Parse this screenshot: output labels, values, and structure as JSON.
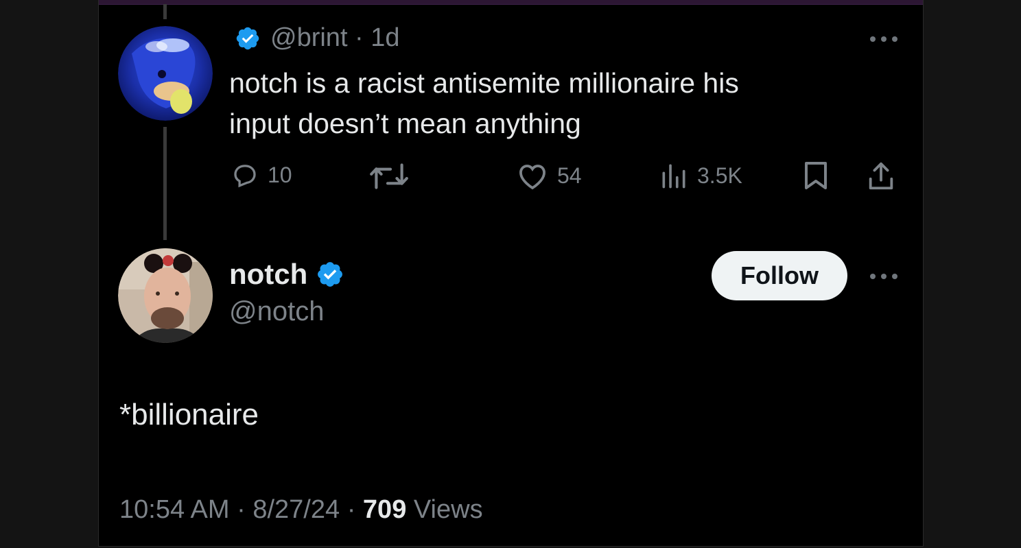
{
  "reply": {
    "handle": "@brint",
    "separator": " · ",
    "age": "1d",
    "text_line1": "notch is a racist antisemite millionaire his",
    "text_line2": "input doesn’t mean anything",
    "stats": {
      "replies": "10",
      "retweets": "",
      "likes": "54",
      "views": "3.5K"
    }
  },
  "tweet": {
    "author_name": "notch",
    "author_handle": "@notch",
    "follow_label": "Follow",
    "text": "*billionaire",
    "time": "10:54 AM",
    "dot1": " · ",
    "date": "8/27/24",
    "dot2": " · ",
    "views_count": "709",
    "views_label": " Views"
  },
  "colors": {
    "verified": "#1d9bf0",
    "background": "#000000",
    "muted": "#7d8389",
    "accent_bar": "#2c1633"
  },
  "icons": [
    "verified-badge-icon",
    "reply-icon",
    "retweet-icon",
    "like-icon",
    "views-icon",
    "bookmark-icon",
    "share-icon",
    "more-icon"
  ]
}
